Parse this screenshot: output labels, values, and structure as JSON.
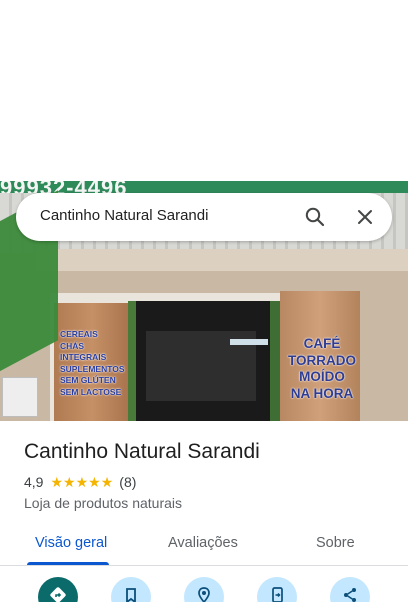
{
  "search": {
    "query": "Cantinho Natural Sarandi"
  },
  "photo": {
    "sign_top_text": "99932-4496",
    "left_list": [
      "CEREAIS",
      "CHÁS",
      "INTEGRAIS",
      "SUPLEMENTOS",
      "SEM GLÚTEN",
      "SEM LACTOSE"
    ],
    "cafe_lines": [
      "CAFÉ",
      "TORRADO",
      "MOÍDO",
      "NA HORA"
    ]
  },
  "place": {
    "name": "Cantinho Natural Sarandi",
    "rating": "4,9",
    "stars": 5,
    "review_count": "(8)",
    "category": "Loja de produtos naturais"
  },
  "tabs": [
    {
      "label": "Visão geral",
      "active": true
    },
    {
      "label": "Avaliações",
      "active": false
    },
    {
      "label": "Sobre",
      "active": false
    }
  ],
  "actions": [
    {
      "icon": "directions-icon"
    },
    {
      "icon": "save-icon"
    },
    {
      "icon": "nearby-icon"
    },
    {
      "icon": "send-to-phone-icon"
    },
    {
      "icon": "share-icon"
    }
  ],
  "colors": {
    "accent": "#0b57d0",
    "star": "#f4b400",
    "primary_action": "#0b6b6b",
    "secondary_action": "#c2e7ff"
  }
}
